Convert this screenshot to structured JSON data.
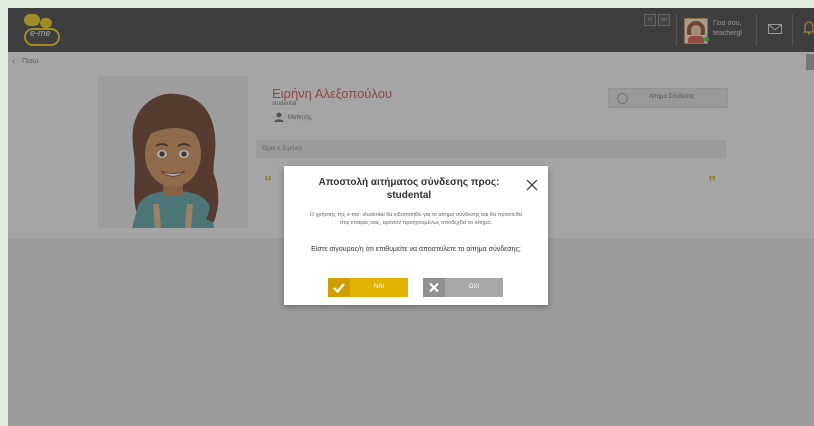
{
  "header": {
    "logo_text": "e-me",
    "lang_options": [
      "el",
      "en"
    ],
    "greeting_line1": "Γεια σου,",
    "greeting_line2": "teachergl"
  },
  "nav": {
    "back_label": "Πίσω"
  },
  "profile": {
    "name": "Ειρήνη Αλεξοπούλου",
    "username": "studental",
    "role": "Μαθητής",
    "about": "Είμαι η Ειρήνη!",
    "request_button": "Αίτημα Σύνδεσης"
  },
  "modal": {
    "title": "Αποστολή αιτήματος σύνδεσης προς: studental",
    "body": "Ο χρήστης της e-me: studental θα ειδοποιηθεί για το αίτημα σύνδεσης και θα προστεθεί στις επαφές σας, εφόσον προηγουμένως αποδεχθεί το αίτημα.",
    "question": "Είστε σίγουρος/η ότι επιθυμείτε να αποστείλετε το αίτημα σύνδεσης;",
    "yes_label": "ΝΑΙ",
    "no_label": "ΟΧΙ"
  },
  "colors": {
    "accent_yellow": "#e2b200",
    "name_red": "#c9413b",
    "topbar": "#2f2f2f"
  },
  "icons": {
    "logo": "bee-logo-icon",
    "mail": "mail-icon",
    "bell": "bell-icon",
    "close": "close-icon",
    "check": "check-icon",
    "x": "x-icon",
    "user": "user-icon",
    "quote": "quote-icon"
  }
}
